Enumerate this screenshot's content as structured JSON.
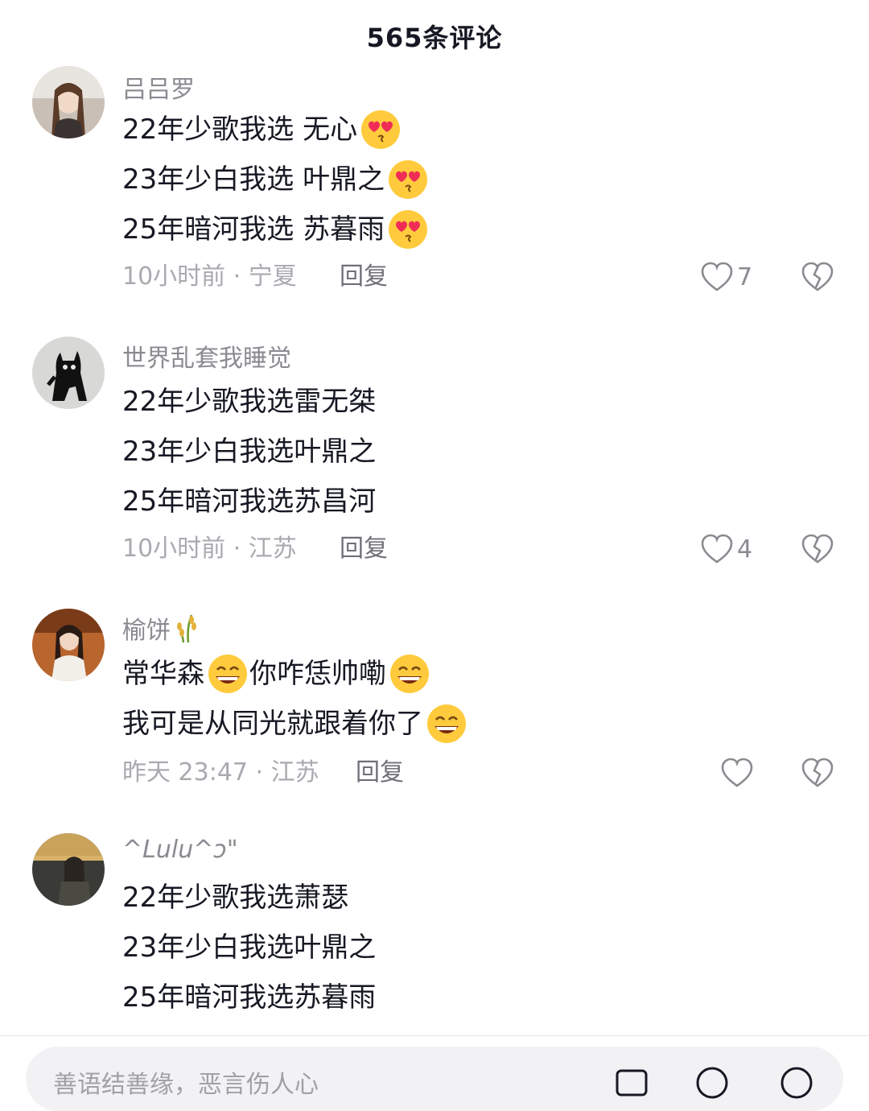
{
  "header": {
    "title": "565条评论"
  },
  "comments": [
    {
      "username": "吕吕罗",
      "lines": [
        "22年少歌我选 无心",
        "23年少白我选 叶鼎之",
        "25年暗河我选 苏暮雨"
      ],
      "line_emojis": [
        "heart-eyes-kiss-emoji",
        "heart-eyes-kiss-emoji",
        "heart-eyes-kiss-emoji"
      ],
      "time_location": "10小时前 · 宁夏",
      "reply_label": "回复",
      "like_count": "7"
    },
    {
      "username": "世界乱套我睡觉",
      "lines": [
        "22年少歌我选雷无桀",
        "23年少白我选叶鼎之",
        "25年暗河我选苏昌河"
      ],
      "time_location": "10小时前 · 江苏",
      "reply_label": "回复",
      "like_count": "4"
    },
    {
      "username": "榆饼",
      "lines": [
        "常华森",
        "你咋恁帅嘞",
        "我可是从同光就跟着你了"
      ],
      "line_emojis": [
        "grin-emoji"
      ],
      "time_location": "昨天 23:47 · 江苏",
      "reply_label": "回复",
      "like_count": ""
    },
    {
      "username": "^Lulu^ɔ\"",
      "lines": [
        "22年少歌我选萧瑟",
        "23年少白我选叶鼎之",
        "25年暗河我选苏暮雨"
      ]
    }
  ],
  "input": {
    "placeholder": "善语结善缘，恶言伤人心"
  },
  "colors": {
    "text": "#161823",
    "meta": "#a9aab0",
    "username": "#8a8b91"
  }
}
